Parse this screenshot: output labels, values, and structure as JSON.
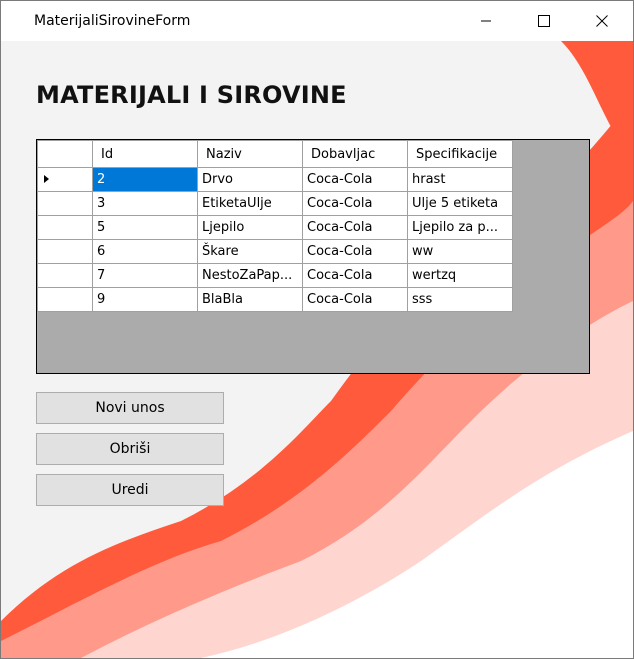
{
  "window": {
    "title": "MaterijaliSirovineForm",
    "controls": {
      "minimize_icon": "minimize-icon",
      "maximize_icon": "maximize-icon",
      "close_icon": "close-icon"
    }
  },
  "page": {
    "heading": "MATERIJALI I SIROVINE"
  },
  "grid": {
    "columns": [
      "Id",
      "Naziv",
      "Dobavljac",
      "Specifikacije"
    ],
    "rows": [
      {
        "id": "2",
        "naziv": "Drvo",
        "dobavljac": "Coca-Cola",
        "specifikacije": "hrast",
        "current": true
      },
      {
        "id": "3",
        "naziv": "EtiketaUlje",
        "dobavljac": "Coca-Cola",
        "specifikacije": "Ulje 5 etiketa"
      },
      {
        "id": "5",
        "naziv": "Ljepilo",
        "dobavljac": "Coca-Cola",
        "specifikacije": "Ljepilo za p..."
      },
      {
        "id": "6",
        "naziv": "Škare",
        "dobavljac": "Coca-Cola",
        "specifikacije": "ww"
      },
      {
        "id": "7",
        "naziv": "NestoZaPap...",
        "dobavljac": "Coca-Cola",
        "specifikacije": "wertzq"
      },
      {
        "id": "9",
        "naziv": "BlaBla",
        "dobavljac": "Coca-Cola",
        "specifikacije": "sss"
      }
    ]
  },
  "buttons": {
    "new": "Novi unos",
    "delete": "Obriši",
    "edit": "Uredi"
  },
  "colors": {
    "accent_selection": "#0078d7",
    "wave_dark": "#ff5a3c",
    "wave_mid": "#ff9a8a",
    "wave_light": "#ffd5cf"
  }
}
